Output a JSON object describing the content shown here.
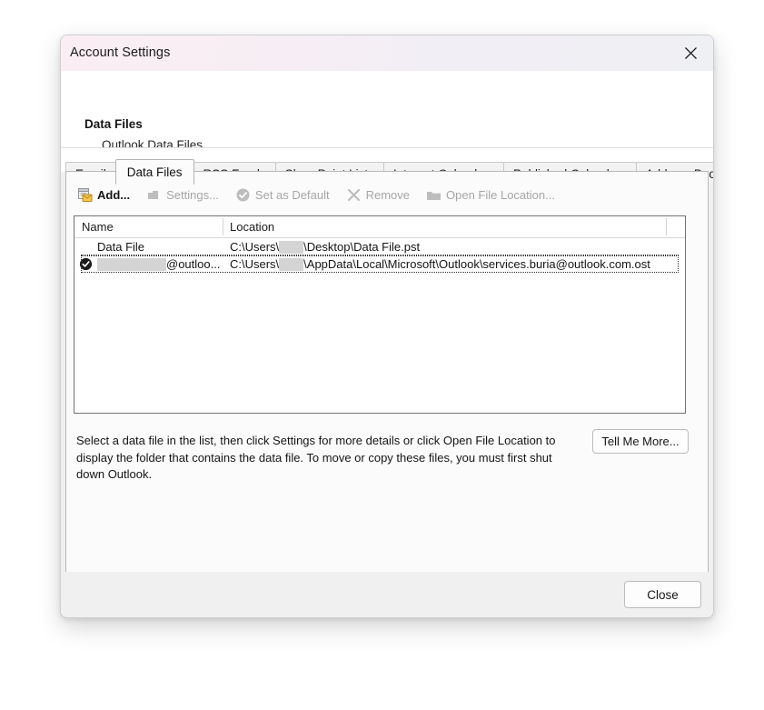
{
  "window": {
    "title": "Account Settings",
    "close_icon": "close-icon"
  },
  "header": {
    "title": "Data Files",
    "subtitle": "Outlook Data Files"
  },
  "tabs": [
    {
      "label": "Email",
      "active": false
    },
    {
      "label": "Data Files",
      "active": true
    },
    {
      "label": "RSS Feeds",
      "active": false
    },
    {
      "label": "SharePoint Lists",
      "active": false
    },
    {
      "label": "Internet Calendars",
      "active": false
    },
    {
      "label": "Published Calendars",
      "active": false
    },
    {
      "label": "Address Books",
      "active": false
    }
  ],
  "toolbar": [
    {
      "label": "Add...",
      "icon": "add-data-file-icon",
      "enabled": true
    },
    {
      "label": "Settings...",
      "icon": "settings-icon",
      "enabled": false
    },
    {
      "label": "Set as Default",
      "icon": "check-circle-icon",
      "enabled": false
    },
    {
      "label": "Remove",
      "icon": "remove-x-icon",
      "enabled": false
    },
    {
      "label": "Open File Location...",
      "icon": "folder-icon",
      "enabled": false
    }
  ],
  "list": {
    "columns": [
      "Name",
      "Location"
    ],
    "rows": [
      {
        "is_default": false,
        "name": "Data File",
        "name_redacted": false,
        "location_prefix": "C:\\Users\\",
        "location_suffix": "\\Desktop\\Data File.pst",
        "selected": false
      },
      {
        "is_default": true,
        "name_prefix": "",
        "name_suffix": "@outloo...",
        "name_redacted": true,
        "location_prefix": "C:\\Users\\",
        "location_suffix": "\\AppData\\Local\\Microsoft\\Outlook\\services.buria@outlook.com.ost",
        "selected": true
      }
    ]
  },
  "description": "Select a data file in the list, then click Settings for more details or click Open File Location to display the folder that contains the data file. To move or copy these files, you must first shut down Outlook.",
  "buttons": {
    "tell_me_more": "Tell Me More...",
    "close": "Close"
  },
  "colors": {
    "titlebar_gradient_start": "#faeef4",
    "titlebar_gradient_end": "#eff0f4",
    "dialog_bg": "#f0f0f0",
    "panel_bg": "#fbfbfb",
    "list_border": "#6f7276",
    "disabled_text": "#a6a6a6"
  }
}
